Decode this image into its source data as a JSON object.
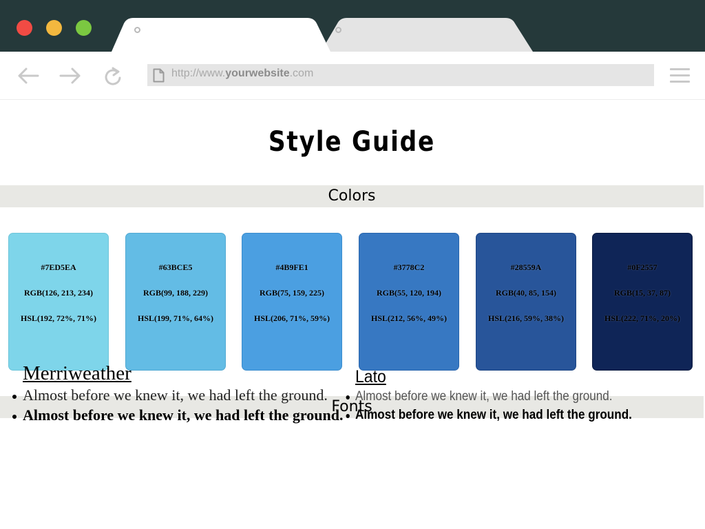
{
  "window_controls": {
    "close_color": "#f14b44",
    "minimize_color": "#f3b83f",
    "maximize_color": "#7bc841"
  },
  "tabs": [
    {
      "state": "active"
    },
    {
      "state": "inactive"
    }
  ],
  "toolbar": {
    "back_icon": "arrow-left-icon",
    "forward_icon": "arrow-right-icon",
    "reload_icon": "reload-icon",
    "menu_icon": "hamburger-menu-icon",
    "url": {
      "prefix": "http://www.",
      "domain": "yourwebsite",
      "suffix": ".com"
    }
  },
  "page": {
    "title": "Style Guide",
    "colors_section_title": "Colors",
    "fonts_section_title": "Fonts",
    "swatches": [
      {
        "hex": "#7ED5EA",
        "rgb": "RGB(126, 213, 234)",
        "hsl": "HSL(192, 72%, 71%)",
        "color": "#7ED5EA",
        "border": "#6ec5da"
      },
      {
        "hex": "#63BCE5",
        "rgb": "RGB(99, 188, 229)",
        "hsl": "HSL(199, 71%, 64%)",
        "color": "#63BCE5",
        "border": "#52a9d3"
      },
      {
        "hex": "#4B9FE1",
        "rgb": "RGB(75, 159, 225)",
        "hsl": "HSL(206, 71%, 59%)",
        "color": "#4B9FE1",
        "border": "#3a8cce"
      },
      {
        "hex": "#3778C2",
        "rgb": "RGB(55, 120, 194)",
        "hsl": "HSL(212, 56%, 49%)",
        "color": "#3778C2",
        "border": "#2865ad"
      },
      {
        "hex": "#28559A",
        "rgb": "RGB(40, 85, 154)",
        "hsl": "HSL(216, 59%, 38%)",
        "color": "#28559A",
        "border": "#1c4584"
      },
      {
        "hex": "#0F2557",
        "rgb": "RGB(15, 37, 87)",
        "hsl": "HSL(222, 71%, 20%)",
        "color": "#0F2557",
        "border": "#0a1a40"
      }
    ],
    "fonts": [
      {
        "name": "Merriweather",
        "samples": [
          {
            "weight": "regular",
            "text": "Almost before we knew it, we had left the ground."
          },
          {
            "weight": "bold",
            "text": "Almost before we knew it, we had left the ground."
          }
        ]
      },
      {
        "name": "Lato",
        "samples": [
          {
            "weight": "regular",
            "text": "Almost before we knew it, we had left the ground."
          },
          {
            "weight": "bold",
            "text": "Almost before we knew it, we had left the ground."
          }
        ]
      }
    ]
  }
}
